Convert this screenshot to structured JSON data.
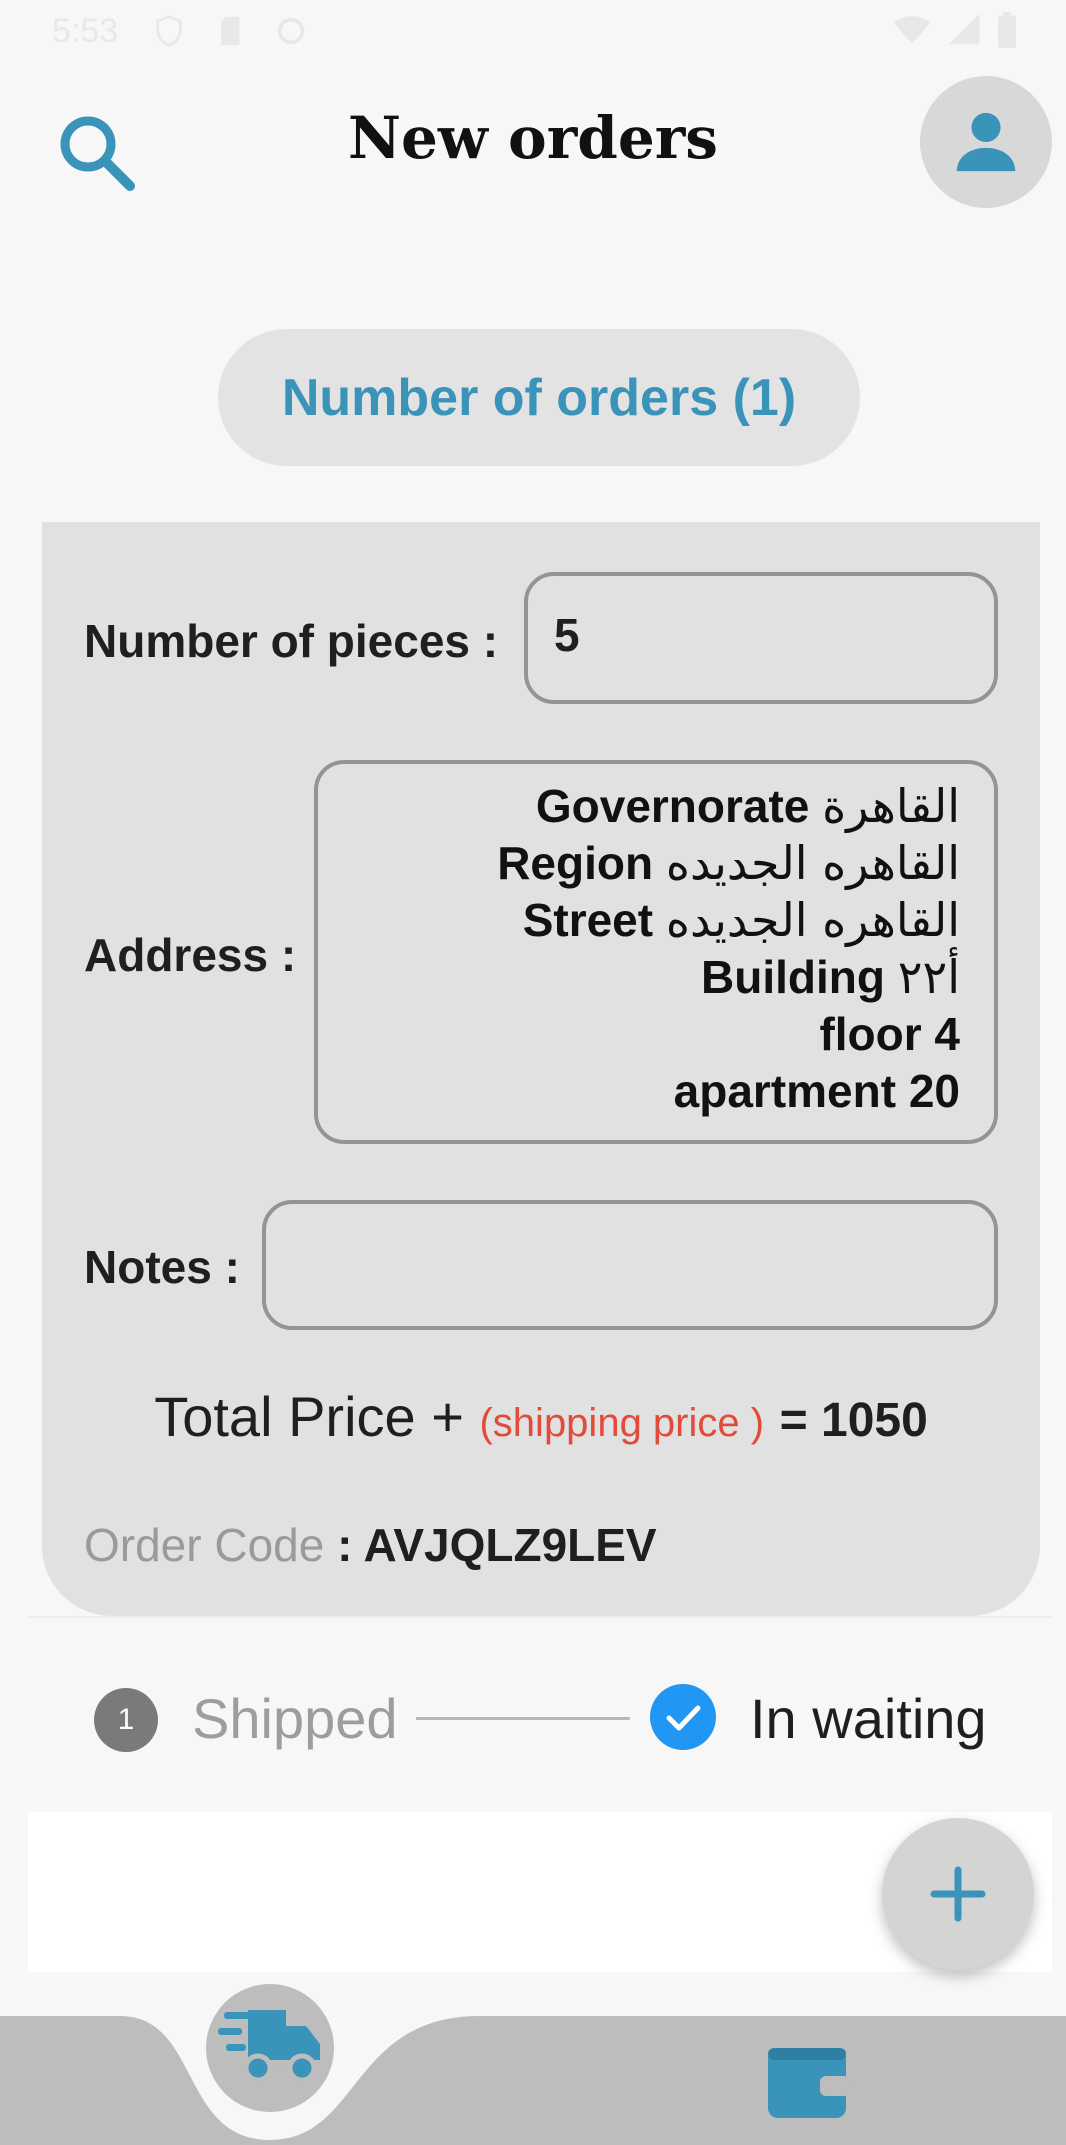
{
  "status_bar": {
    "time": "5:53"
  },
  "header": {
    "title": "New orders",
    "search_icon": "search-icon",
    "avatar_icon": "person-icon"
  },
  "orders_count": {
    "label": "Number of orders (1)"
  },
  "order": {
    "pieces_label": "Number of pieces :",
    "pieces_value": "5",
    "address_label": "Address :",
    "address": {
      "governorate_label": "Governorate",
      "governorate_value": "القاهرة",
      "region_label": "Region",
      "region_value": "القاهره الجديده",
      "street_label": "Street",
      "street_value": "القاهره الجديده",
      "building_label": "Building",
      "building_value": "أ٢٢",
      "floor": "floor 4",
      "apartment": "apartment 20"
    },
    "notes_label": "Notes :",
    "notes_value": "",
    "total_label": "Total Price +",
    "shipping_label": "(shipping price )",
    "total_value": "= 1050",
    "code_label": "Order Code",
    "code_value": ": AVJQLZ9LEV"
  },
  "status_steps": [
    {
      "marker": "1",
      "label": "Shipped",
      "active": false
    },
    {
      "marker": "check",
      "label": "In waiting",
      "active": true
    }
  ],
  "colors": {
    "accent": "#3a93b8",
    "shipping": "#e24a3a",
    "check": "#2196f3",
    "card": "#e1e1e1",
    "nav": "#bdbdbd"
  },
  "fab": {
    "icon": "plus-icon"
  },
  "bottom_nav": [
    {
      "icon": "truck-icon"
    },
    {
      "icon": "wallet-icon"
    }
  ]
}
